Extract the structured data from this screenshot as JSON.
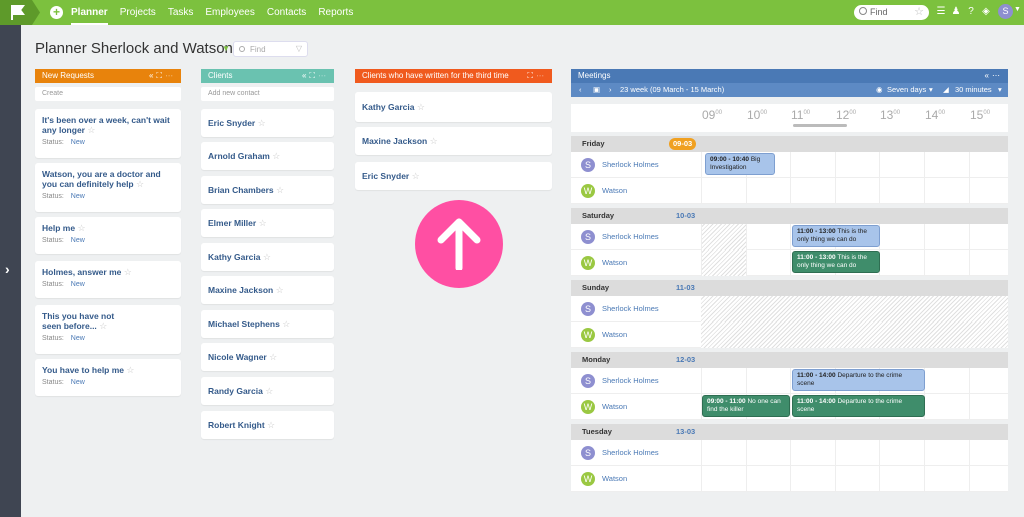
{
  "nav": {
    "items": [
      {
        "label": "Planner",
        "active": true
      },
      {
        "label": "Projects"
      },
      {
        "label": "Tasks"
      },
      {
        "label": "Employees"
      },
      {
        "label": "Contacts"
      },
      {
        "label": "Reports"
      }
    ],
    "search_placeholder": "Find",
    "user_initial": "S"
  },
  "page": {
    "title": "Planner Sherlock and Watson",
    "search_placeholder": "Find"
  },
  "columns": {
    "requests": {
      "title": "New Requests",
      "color": "#e8830c",
      "input_placeholder": "Create",
      "status_label": "Status:",
      "cards": [
        {
          "title": "It's been over a week, can't wait any longer",
          "status": "New"
        },
        {
          "title": "Watson, you are a doctor and you can definitely help",
          "status": "New"
        },
        {
          "title": "Help me",
          "status": "New"
        },
        {
          "title": "Holmes, answer me",
          "status": "New"
        },
        {
          "title": "This you have not seen before...",
          "status": "New"
        },
        {
          "title": "You have to help me",
          "status": "New"
        }
      ]
    },
    "clients": {
      "title": "Clients",
      "color": "#6ac2b0",
      "input_placeholder": "Add new contact",
      "cards": [
        "Eric Snyder",
        "Arnold Graham",
        "Brian Chambers",
        "Elmer Miller",
        "Kathy Garcia",
        "Maxine Jackson",
        "Michael Stephens",
        "Nicole Wagner",
        "Randy Garcia",
        "Robert Knight"
      ]
    },
    "third": {
      "title": "Clients who have written for the third time",
      "color": "#f05a1e",
      "cards": [
        "Kathy Garcia",
        "Maxine Jackson",
        "Eric Snyder"
      ]
    }
  },
  "meetings": {
    "title": "Meetings",
    "week": "23 week (09 March - 15 March)",
    "range": "Seven days",
    "interval": "30 minutes",
    "hours": [
      "09",
      "10",
      "11",
      "12",
      "13",
      "14",
      "15"
    ],
    "hour_suffix": "00",
    "people": [
      {
        "name": "Sherlock Holmes",
        "initial": "S",
        "color": "#8e8fd0"
      },
      {
        "name": "Watson",
        "initial": "W",
        "color": "#9ac842"
      }
    ],
    "days": [
      {
        "name": "Friday",
        "date": "09-03"
      },
      {
        "name": "Saturday",
        "date": "10-03"
      },
      {
        "name": "Sunday",
        "date": "11-03"
      },
      {
        "name": "Monday",
        "date": "12-03"
      },
      {
        "name": "Tuesday",
        "date": "13-03"
      }
    ],
    "events": [
      {
        "time": "09:00 - 10:40",
        "text": "Big Investigation"
      },
      {
        "time": "11:00 - 13:00",
        "text": "This is the only thing we can do"
      },
      {
        "time": "11:00 - 13:00",
        "text": "This is the only thing we can do"
      },
      {
        "time": "11:00 - 14:00",
        "text": "Departure to the crime scene"
      },
      {
        "time": "09:00 - 11:00",
        "text": "No one can find the killer"
      },
      {
        "time": "11:00 - 14:00",
        "text": "Departure to the crime scene"
      }
    ]
  }
}
